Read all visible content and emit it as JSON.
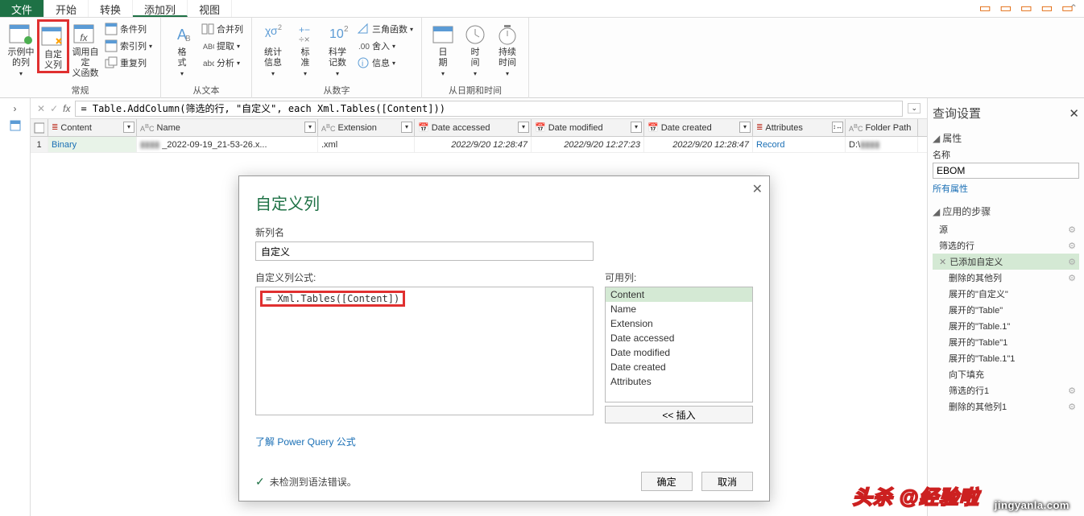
{
  "menubar": {
    "file": "文件",
    "home": "开始",
    "transform": "转换",
    "addcol": "添加列",
    "view": "视图"
  },
  "ribbon": {
    "group_general": {
      "label": "常规",
      "example_col": "示例中\n的列",
      "custom_col": "自定\n义列",
      "invoke_func": "调用自定\n义函数",
      "cond_col": "条件列",
      "index_col": "索引列",
      "dup_col": "重复列"
    },
    "group_text": {
      "label": "从文本",
      "format": "格\n式",
      "merge": "合并列",
      "extract": "提取",
      "parse": "分析"
    },
    "group_number": {
      "label": "从数字",
      "stats": "统计\n信息",
      "standard": "标\n准",
      "scientific": "科学\n记数",
      "info": "信息",
      "trig": "三角函数",
      "round": "舍入"
    },
    "group_datetime": {
      "label": "从日期和时间",
      "date": "日\n期",
      "time": "时\n间",
      "duration": "持续\n时间"
    }
  },
  "formula_bar": {
    "formula": "= Table.AddColumn(筛选的行, \"自定义\", each Xml.Tables([Content]))"
  },
  "grid": {
    "headers": {
      "rownum": "",
      "content": "Content",
      "name": "Name",
      "extension": "Extension",
      "date_accessed": "Date accessed",
      "date_modified": "Date modified",
      "date_created": "Date created",
      "attributes": "Attributes",
      "folder_path": "Folder Path"
    },
    "rows": [
      {
        "num": "1",
        "content": "Binary",
        "name": "_2022-09-19_21-53-26.x...",
        "extension": ".xml",
        "date_accessed": "2022/9/20 12:28:47",
        "date_modified": "2022/9/20 12:27:23",
        "date_created": "2022/9/20 12:28:47",
        "attributes": "Record",
        "folder_path": "D:\\"
      }
    ]
  },
  "dialog": {
    "title": "自定义列",
    "new_col_label": "新列名",
    "new_col_value": "自定义",
    "formula_label": "自定义列公式:",
    "formula_value": "= Xml.Tables([Content])",
    "avail_label": "可用列:",
    "avail": [
      "Content",
      "Name",
      "Extension",
      "Date accessed",
      "Date modified",
      "Date created",
      "Attributes"
    ],
    "insert": "<< 插入",
    "learn_link": "了解 Power Query 公式",
    "status": "未检测到语法错误。",
    "ok": "确定",
    "cancel": "取消"
  },
  "right_panel": {
    "title": "查询设置",
    "props": "属性",
    "name_label": "名称",
    "name_value": "EBOM",
    "all_props": "所有属性",
    "steps_label": "应用的步骤",
    "steps": [
      {
        "t": "源",
        "g": true
      },
      {
        "t": "筛选的行",
        "g": true
      },
      {
        "t": "已添加自定义",
        "sel": true,
        "x": true,
        "g": true
      },
      {
        "t": "删除的其他列",
        "indent": true,
        "g": true
      },
      {
        "t": "展开的\"自定义\"",
        "indent": true
      },
      {
        "t": "展开的\"Table\"",
        "indent": true
      },
      {
        "t": "展开的\"Table.1\"",
        "indent": true
      },
      {
        "t": "展开的\"Table\"1",
        "indent": true
      },
      {
        "t": "展开的\"Table.1\"1",
        "indent": true
      },
      {
        "t": "向下填充",
        "indent": true
      },
      {
        "t": "筛选的行1",
        "indent": true,
        "g": true
      },
      {
        "t": "删除的其他列1",
        "indent": true,
        "g": true
      }
    ]
  },
  "watermark": {
    "site": "jingyanla.com",
    "brand": "头杀 @经验啦"
  }
}
